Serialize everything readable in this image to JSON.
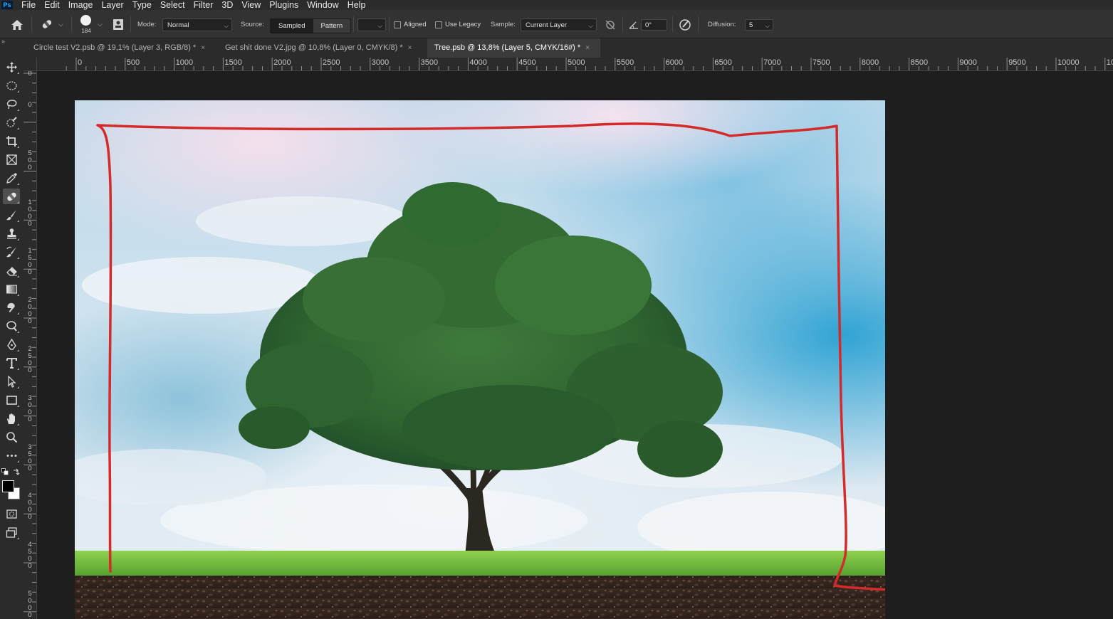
{
  "app": {
    "logo": "Ps"
  },
  "menu": [
    "File",
    "Edit",
    "Image",
    "Layer",
    "Type",
    "Select",
    "Filter",
    "3D",
    "View",
    "Plugins",
    "Window",
    "Help"
  ],
  "options": {
    "brush_size": "184",
    "mode_label": "Mode:",
    "mode_value": "Normal",
    "source_label": "Source:",
    "source_sampled": "Sampled",
    "source_pattern": "Pattern",
    "aligned_label": "Aligned",
    "use_legacy_label": "Use Legacy",
    "sample_label": "Sample:",
    "sample_value": "Current Layer",
    "angle_value": "0°",
    "diffusion_label": "Diffusion:",
    "diffusion_value": "5"
  },
  "tabs": [
    {
      "label": "Circle test V2.psb @ 19,1% (Layer 3, RGB/8) *",
      "active": false
    },
    {
      "label": "Get shit done V2.jpg @ 10,8% (Layer 0, CMYK/8) *",
      "active": false
    },
    {
      "label": "Tree.psb @ 13,8% (Layer 5, CMYK/16#) *",
      "active": true
    }
  ],
  "tab_close": "×",
  "ruler": {
    "top_labels": [
      "0",
      "500",
      "1000",
      "1500",
      "2000",
      "2500",
      "3000",
      "3500",
      "4000",
      "4500",
      "5000",
      "5500",
      "6000",
      "6500",
      "7000",
      "7500",
      "8000",
      "8500",
      "9000",
      "9500",
      "10000",
      "10"
    ],
    "left_labels": [
      "0",
      "0",
      "500",
      "1000",
      "1500",
      "2000",
      "2500",
      "3000",
      "3500",
      "4000",
      "4500",
      "5000"
    ]
  },
  "tools": [
    "move-icon",
    "marquee-icon",
    "lasso-icon",
    "quick-select-icon",
    "crop-icon",
    "frame-icon",
    "eyedropper-icon",
    "healing-brush-icon",
    "brush-icon",
    "clone-stamp-icon",
    "history-brush-icon",
    "eraser-icon",
    "gradient-icon",
    "smudge-icon",
    "dodge-icon",
    "pen-icon",
    "type-icon",
    "path-select-icon",
    "rectangle-icon",
    "hand-icon",
    "zoom-icon",
    "more-tools-icon"
  ],
  "colors": {
    "foreground": "#000000",
    "background": "#ffffff",
    "annotation": "#d42a2a"
  }
}
